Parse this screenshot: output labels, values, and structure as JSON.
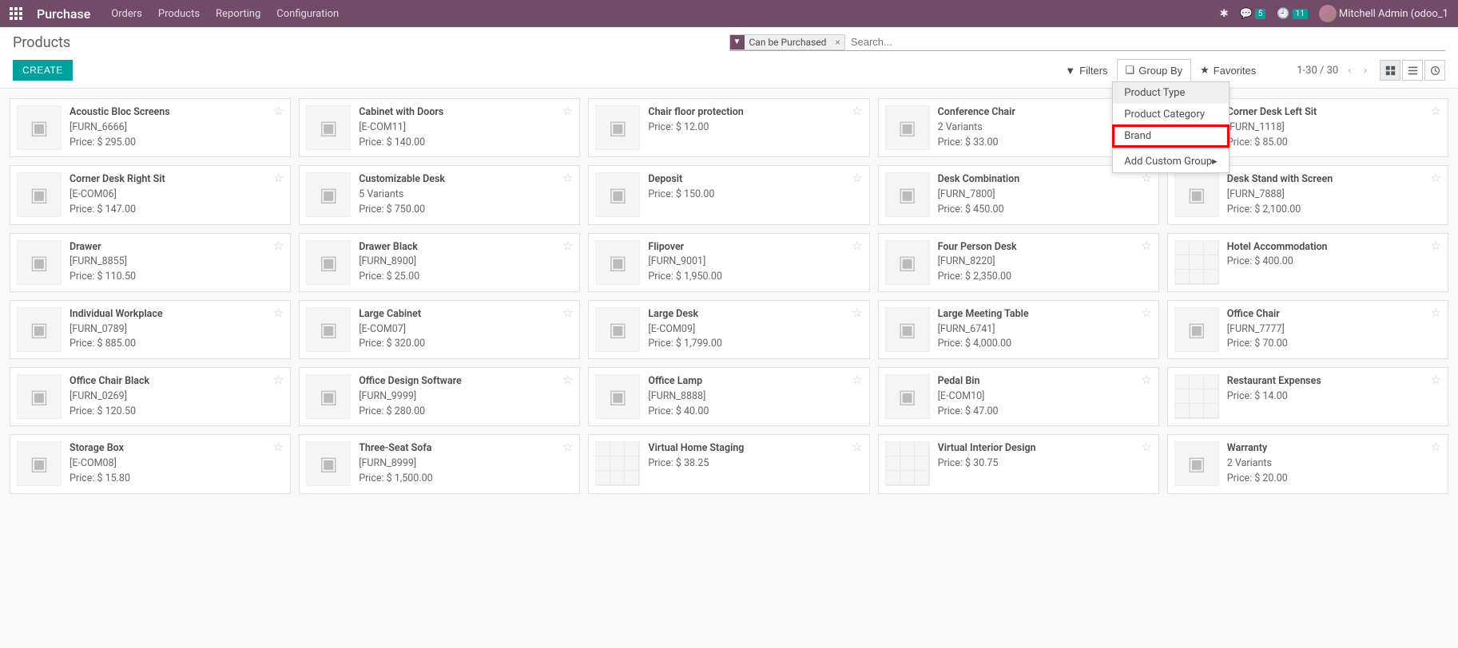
{
  "navbar": {
    "brand": "Purchase",
    "menu": [
      "Orders",
      "Products",
      "Reporting",
      "Configuration"
    ],
    "messages_badge": "5",
    "activities_badge": "11",
    "user": "Mitchell Admin (odoo_1"
  },
  "breadcrumb": "Products",
  "search": {
    "facet_label": "Can be Purchased",
    "placeholder": "Search..."
  },
  "buttons": {
    "create": "CREATE",
    "filters": "Filters",
    "groupby": "Group By",
    "favorites": "Favorites"
  },
  "groupby_menu": {
    "items": [
      "Product Type",
      "Product Category",
      "Brand"
    ],
    "custom": "Add Custom Group"
  },
  "pager": {
    "range": "1-30 / 30"
  },
  "products": [
    {
      "name": "Acoustic Bloc Screens",
      "ref": "[FURN_6666]",
      "price": "Price: $ 295.00",
      "img": "box"
    },
    {
      "name": "Cabinet with Doors",
      "ref": "[E-COM11]",
      "price": "Price: $ 140.00",
      "img": "box"
    },
    {
      "name": "Chair floor protection",
      "ref": "",
      "price": "Price: $ 12.00",
      "img": "box"
    },
    {
      "name": "Conference Chair",
      "ref": "2 Variants",
      "price": "Price: $ 33.00",
      "img": "box"
    },
    {
      "name": "Corner Desk Left Sit",
      "ref": "[FURN_1118]",
      "price": "Price: $ 85.00",
      "img": "box"
    },
    {
      "name": "Corner Desk Right Sit",
      "ref": "[E-COM06]",
      "price": "Price: $ 147.00",
      "img": "box"
    },
    {
      "name": "Customizable Desk",
      "ref": "5 Variants",
      "price": "Price: $ 750.00",
      "img": "box"
    },
    {
      "name": "Deposit",
      "ref": "",
      "price": "Price: $ 150.00",
      "img": "box"
    },
    {
      "name": "Desk Combination",
      "ref": "[FURN_7800]",
      "price": "Price: $ 450.00",
      "img": "box"
    },
    {
      "name": "Desk Stand with Screen",
      "ref": "[FURN_7888]",
      "price": "Price: $ 2,100.00",
      "img": "box"
    },
    {
      "name": "Drawer",
      "ref": "[FURN_8855]",
      "price": "Price: $ 110.50",
      "img": "box"
    },
    {
      "name": "Drawer Black",
      "ref": "[FURN_8900]",
      "price": "Price: $ 25.00",
      "img": "box"
    },
    {
      "name": "Flipover",
      "ref": "[FURN_9001]",
      "price": "Price: $ 1,950.00",
      "img": "box"
    },
    {
      "name": "Four Person Desk",
      "ref": "[FURN_8220]",
      "price": "Price: $ 2,350.00",
      "img": "box"
    },
    {
      "name": "Hotel Accommodation",
      "ref": "",
      "price": "Price: $ 400.00",
      "img": "placeholder"
    },
    {
      "name": "Individual Workplace",
      "ref": "[FURN_0789]",
      "price": "Price: $ 885.00",
      "img": "box"
    },
    {
      "name": "Large Cabinet",
      "ref": "[E-COM07]",
      "price": "Price: $ 320.00",
      "img": "box"
    },
    {
      "name": "Large Desk",
      "ref": "[E-COM09]",
      "price": "Price: $ 1,799.00",
      "img": "box"
    },
    {
      "name": "Large Meeting Table",
      "ref": "[FURN_6741]",
      "price": "Price: $ 4,000.00",
      "img": "box"
    },
    {
      "name": "Office Chair",
      "ref": "[FURN_7777]",
      "price": "Price: $ 70.00",
      "img": "box"
    },
    {
      "name": "Office Chair Black",
      "ref": "[FURN_0269]",
      "price": "Price: $ 120.50",
      "img": "box"
    },
    {
      "name": "Office Design Software",
      "ref": "[FURN_9999]",
      "price": "Price: $ 280.00",
      "img": "box"
    },
    {
      "name": "Office Lamp",
      "ref": "[FURN_8888]",
      "price": "Price: $ 40.00",
      "img": "box"
    },
    {
      "name": "Pedal Bin",
      "ref": "[E-COM10]",
      "price": "Price: $ 47.00",
      "img": "box"
    },
    {
      "name": "Restaurant Expenses",
      "ref": "",
      "price": "Price: $ 14.00",
      "img": "placeholder"
    },
    {
      "name": "Storage Box",
      "ref": "[E-COM08]",
      "price": "Price: $ 15.80",
      "img": "box"
    },
    {
      "name": "Three-Seat Sofa",
      "ref": "[FURN_8999]",
      "price": "Price: $ 1,500.00",
      "img": "box"
    },
    {
      "name": "Virtual Home Staging",
      "ref": "",
      "price": "Price: $ 38.25",
      "img": "placeholder"
    },
    {
      "name": "Virtual Interior Design",
      "ref": "",
      "price": "Price: $ 30.75",
      "img": "placeholder"
    },
    {
      "name": "Warranty",
      "ref": "2 Variants",
      "price": "Price: $ 20.00",
      "img": "box"
    }
  ]
}
